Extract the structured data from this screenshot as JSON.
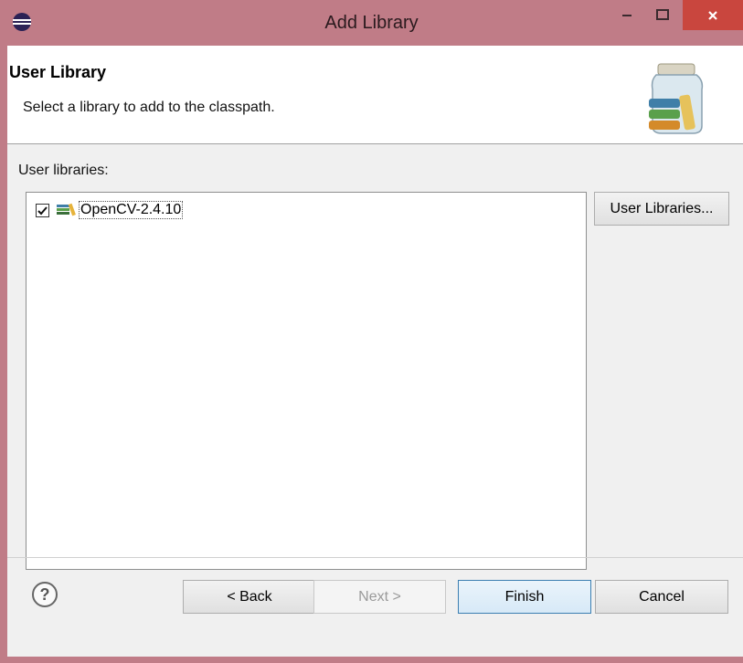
{
  "window": {
    "title": "Add Library",
    "controls": {
      "minimize_icon": "minimize-icon",
      "maximize_icon": "maximize-icon",
      "close_icon": "close-icon"
    },
    "frame_color": "#c07c87",
    "close_color": "#c9463e"
  },
  "header": {
    "title": "User Library",
    "description": "Select a library to add to the classpath.",
    "icon": "library-jar-icon"
  },
  "libraries": {
    "label": "User libraries:",
    "items": [
      {
        "name": "OpenCV-2.4.10",
        "checked": true,
        "icon": "library-books-icon"
      }
    ]
  },
  "buttons": {
    "user_libraries": "User Libraries...",
    "back": "< Back",
    "next": "Next >",
    "finish": "Finish",
    "cancel": "Cancel",
    "help": "?"
  }
}
